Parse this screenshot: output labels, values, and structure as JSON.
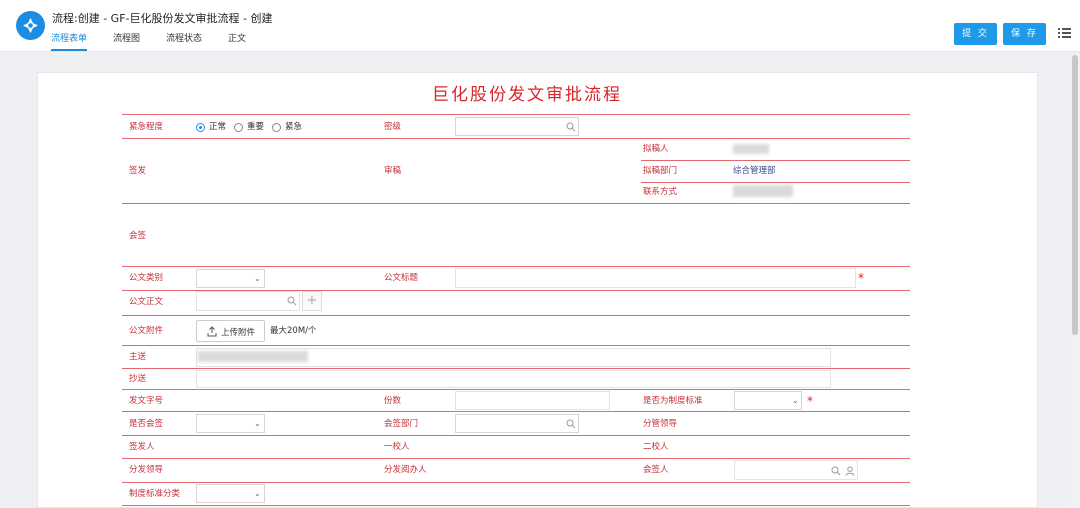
{
  "header": {
    "title": "流程:创建 - GF-巨化股份发文审批流程 - 创建",
    "tabs": [
      {
        "label": "流程表单",
        "active": true
      },
      {
        "label": "流程图",
        "active": false
      },
      {
        "label": "流程状态",
        "active": false
      },
      {
        "label": "正文",
        "active": false
      }
    ],
    "submit_label": "提 交",
    "save_label": "保 存"
  },
  "form": {
    "title": "巨化股份发文审批流程",
    "urgency": {
      "label": "紧急程度",
      "options": [
        "正常",
        "重要",
        "紧急"
      ],
      "selected": "正常"
    },
    "labels": {
      "secret": "密级",
      "sign_issue": "签发",
      "review": "审稿",
      "drafter": "拟稿人",
      "draft_dept": "拟稿部门",
      "contact": "联系方式",
      "countersign": "会签",
      "doc_type": "公文类别",
      "doc_title": "公文标题",
      "doc_body": "公文正文",
      "attachment": "公文附件",
      "main_send": "主送",
      "cc": "抄送",
      "doc_number": "发文字号",
      "copies": "份数",
      "is_standard": "是否为制度标准",
      "is_countersign": "是否会签",
      "countersign_dept": "会签部门",
      "leader_in_charge": "分管领导",
      "issuer": "签发人",
      "proof_one": "一校人",
      "proof_two": "二校人",
      "dist_leader": "分发领导",
      "dist_reader": "分发阅办人",
      "countersigner": "会签人",
      "standard_category": "制度标准分类"
    },
    "values": {
      "draft_dept": "综合管理部"
    },
    "upload_label": "上传附件",
    "upload_limit": "最大20M/个"
  },
  "colors": {
    "accent": "#1f9ae8",
    "form_line": "#e5686c",
    "form_label": "#c4303a",
    "form_title": "#d9252b"
  },
  "icons": [
    "search-icon",
    "chevron-down-icon",
    "upload-icon",
    "plus-icon",
    "user-icon",
    "menu-icon"
  ]
}
